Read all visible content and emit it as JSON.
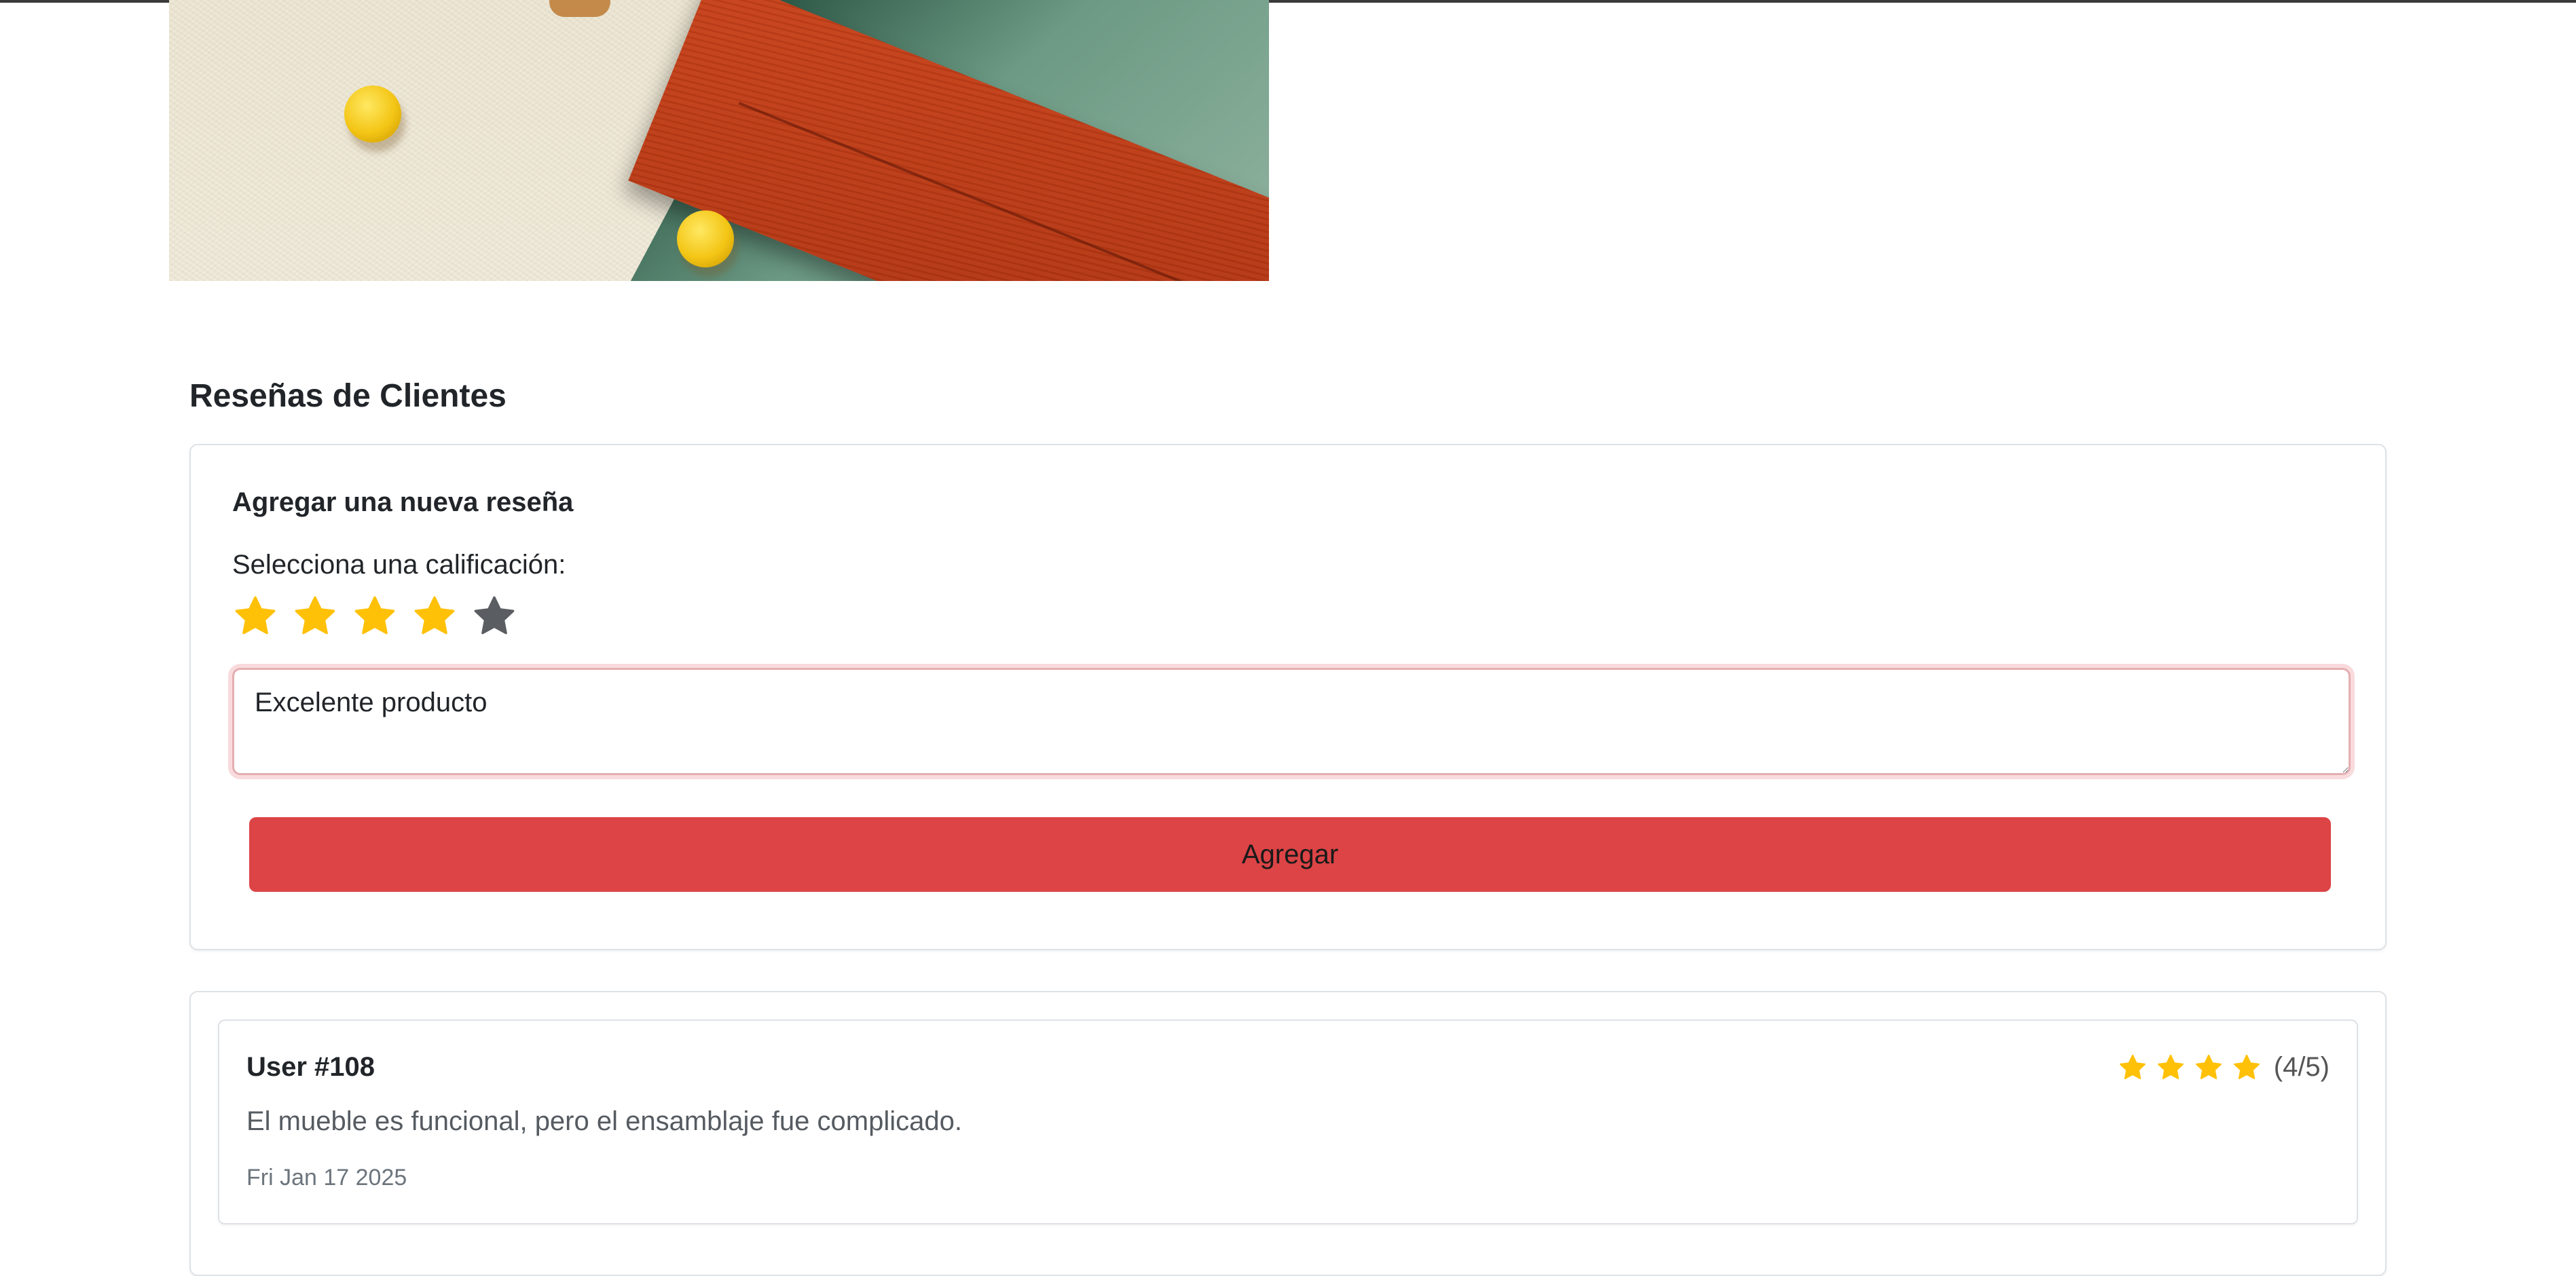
{
  "colors": {
    "star_active": "#ffc107",
    "star_inactive": "#5a5d61",
    "button": "#dc4446",
    "border": "#dee2e6"
  },
  "product_image": {
    "icon": "product-photo-sofa"
  },
  "reviews": {
    "title": "Reseñas de Clientes",
    "form": {
      "title": "Agregar una nueva reseña",
      "rating_label": "Selecciona una calificación:",
      "selected_rating": 4,
      "max_rating": 5,
      "input_value": "Excelente producto",
      "submit_label": "Agregar"
    },
    "items": [
      {
        "user": "User #108",
        "rating": 4,
        "rating_text": "(4/5)",
        "text": "El mueble es funcional, pero el ensamblaje fue complicado.",
        "date": "Fri Jan 17 2025"
      }
    ]
  }
}
